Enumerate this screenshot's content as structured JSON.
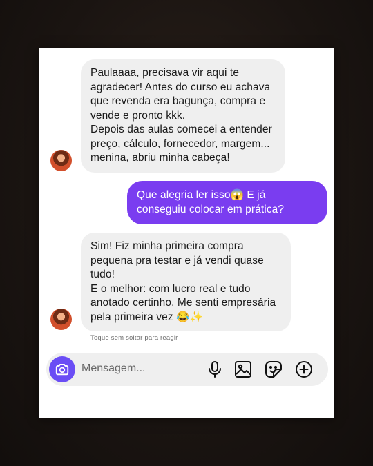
{
  "messages": [
    {
      "from": "contact",
      "paragraphs": [
        "Paulaaaa, precisava vir aqui te agradecer! Antes do curso eu achava que revenda era bagunça, compra e vende e pronto kkk.",
        "Depois das aulas comecei a entender preço, cálculo, fornecedor, margem... menina, abriu minha cabeça!"
      ]
    },
    {
      "from": "me",
      "paragraphs": [
        "Que alegria ler isso😱 E já conseguiu colocar em prática?"
      ]
    },
    {
      "from": "contact",
      "paragraphs": [
        "Sim! Fiz minha primeira compra pequena pra testar e já vendi quase tudo!",
        "E o melhor: com lucro real e tudo anotado certinho. Me senti empresária pela primeira vez 😂✨"
      ]
    }
  ],
  "hint": "Toque sem soltar para reagir",
  "composer": {
    "placeholder": "Mensagem...",
    "icons": [
      "camera-icon",
      "microphone-icon",
      "gallery-icon",
      "sticker-icon",
      "plus-icon"
    ]
  },
  "colors": {
    "outgoing_bubble": "#7a3df0",
    "incoming_bubble": "#efefef",
    "camera_button": "#6a4df5"
  }
}
